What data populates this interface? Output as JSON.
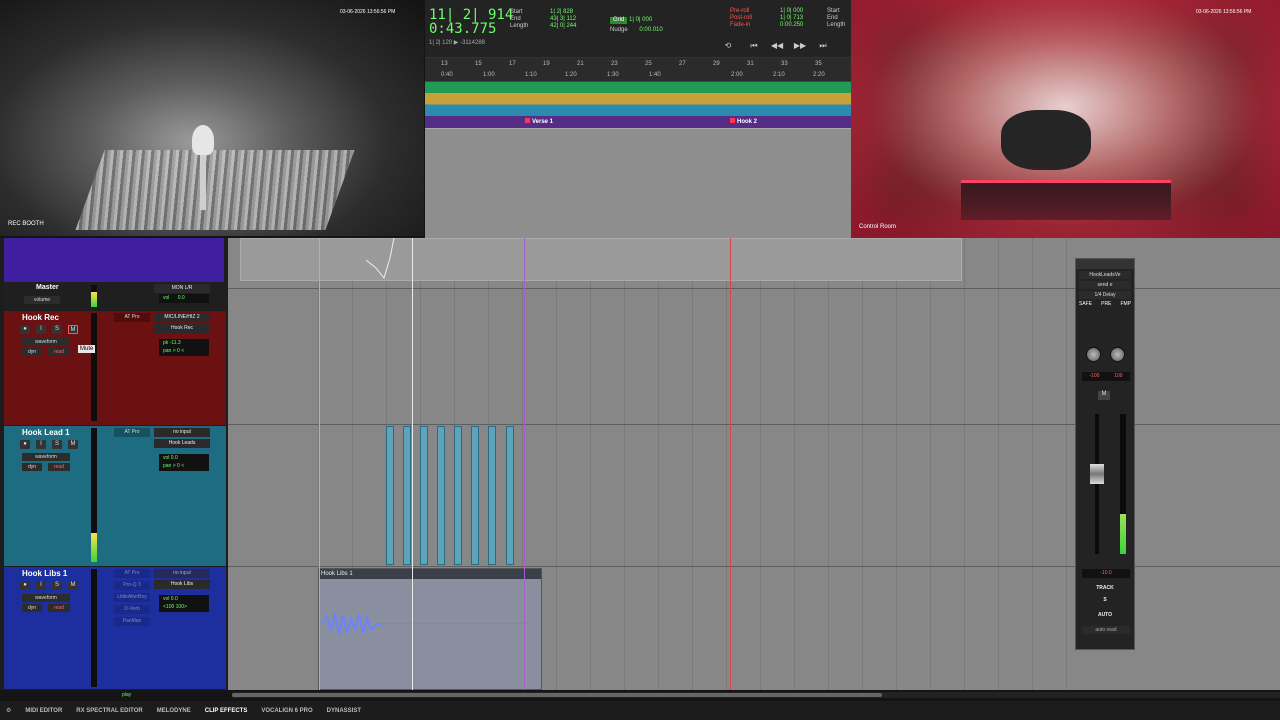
{
  "cameras": {
    "left": {
      "label": "REC BOOTH",
      "timestamp": "03-06-2026 13:56:56 PM"
    },
    "right": {
      "label": "Control Room",
      "timestamp": "03-06-2026 13:56:56 PM"
    }
  },
  "transport": {
    "main_counter": "11| 2| 914",
    "sub_counter": "0:43.775",
    "sub_info": "1| 2| 120  ▶  -3114288",
    "start_end_length": {
      "start": "1| 2| 828",
      "end": "43| 3| 112",
      "length": "42| 0| 244"
    },
    "grid_label": "Grid",
    "grid_value": "1| 0| 000",
    "nudge_label": "Nudge",
    "nudge_value": "0:00.010",
    "preroll": {
      "label1": "Pre-roll",
      "label2": "Post-roll",
      "label3": "Fade-in",
      "v1": "1| 0| 000",
      "v2": "1| 0| 713",
      "v3": "0:00.250"
    },
    "right_labels": {
      "a": "Start",
      "b": "End",
      "c": "Length"
    }
  },
  "ruler": {
    "bars": [
      "13",
      "15",
      "17",
      "19",
      "21",
      "23",
      "25",
      "27",
      "29",
      "31",
      "33",
      "35"
    ],
    "times": [
      "0:40",
      "1:00",
      "1:10",
      "1:20",
      "1:30",
      "1:40",
      "2:00",
      "2:10",
      "2:20"
    ]
  },
  "markers": [
    {
      "label": "Verse 1"
    },
    {
      "label": "Hook 2"
    }
  ],
  "mix": {
    "master": {
      "name": "Master",
      "io": "MON L/R",
      "volume_label": "volume",
      "vol": "vol",
      "vol_val": "0.0"
    },
    "tracks": [
      {
        "name": "Hook Rec",
        "color": "#6b1111",
        "insert": "AT Pro",
        "io_in": "MIC/LINE/HIZ 2",
        "io_out": "Hook Rec",
        "view": "waveform",
        "dyn": "dyn",
        "read": "read",
        "vol_l1": "pk  -11.3",
        "vol_l2": "pan  > 0 <"
      },
      {
        "name": "Hook Lead 1",
        "color": "#1e6c82",
        "insert": "AT Pro",
        "io_in": "no input",
        "io_out": "Hook Leads",
        "view": "waveform",
        "dyn": "dyn",
        "read": "read",
        "vol_l1": "vol      0.0",
        "vol_l2": "pan  > 0 <"
      },
      {
        "name": "Hook Libs 1",
        "color": "#1d2f9e",
        "insert": "AT Pro",
        "io_in": "no input",
        "io_out": "Hook Libs",
        "view": "waveform",
        "dyn": "dyn",
        "read": "read",
        "vol_l1": "vol      0.0",
        "vol_l2": "<100  100>",
        "inserts": [
          "AT Pro",
          "Pro-Q 3",
          "LittleAlterBoy",
          "D-Verb",
          "PanMan"
        ]
      }
    ],
    "tooltip": "Mute",
    "btn_s": "S",
    "btn_m": "M",
    "btn_i": "I"
  },
  "edit": {
    "hook_libs_clip": "Hook Libs 1"
  },
  "output_window": {
    "track": "HookLeadsVe",
    "send": "send e",
    "plugin": "1/4 Delay",
    "safe": "SAFE",
    "pre": "PRE",
    "fmp": "FMP",
    "pan_l": "-100",
    "pan_r": "100",
    "m": "M",
    "volume": "-10.0",
    "track_label": "TRACK",
    "auto_label": "AUTO",
    "auto_mode": "auto read",
    "s_label": "S"
  },
  "bottom_tabs": [
    {
      "label": "MIDI EDITOR"
    },
    {
      "label": "RX SPECTRAL EDITOR"
    },
    {
      "label": "MELODYNE"
    },
    {
      "label": "CLIP EFFECTS",
      "active": true
    },
    {
      "label": "VOCALIGN 6 PRO"
    },
    {
      "label": "DYNASSIST"
    }
  ],
  "status": {
    "play": "play"
  }
}
